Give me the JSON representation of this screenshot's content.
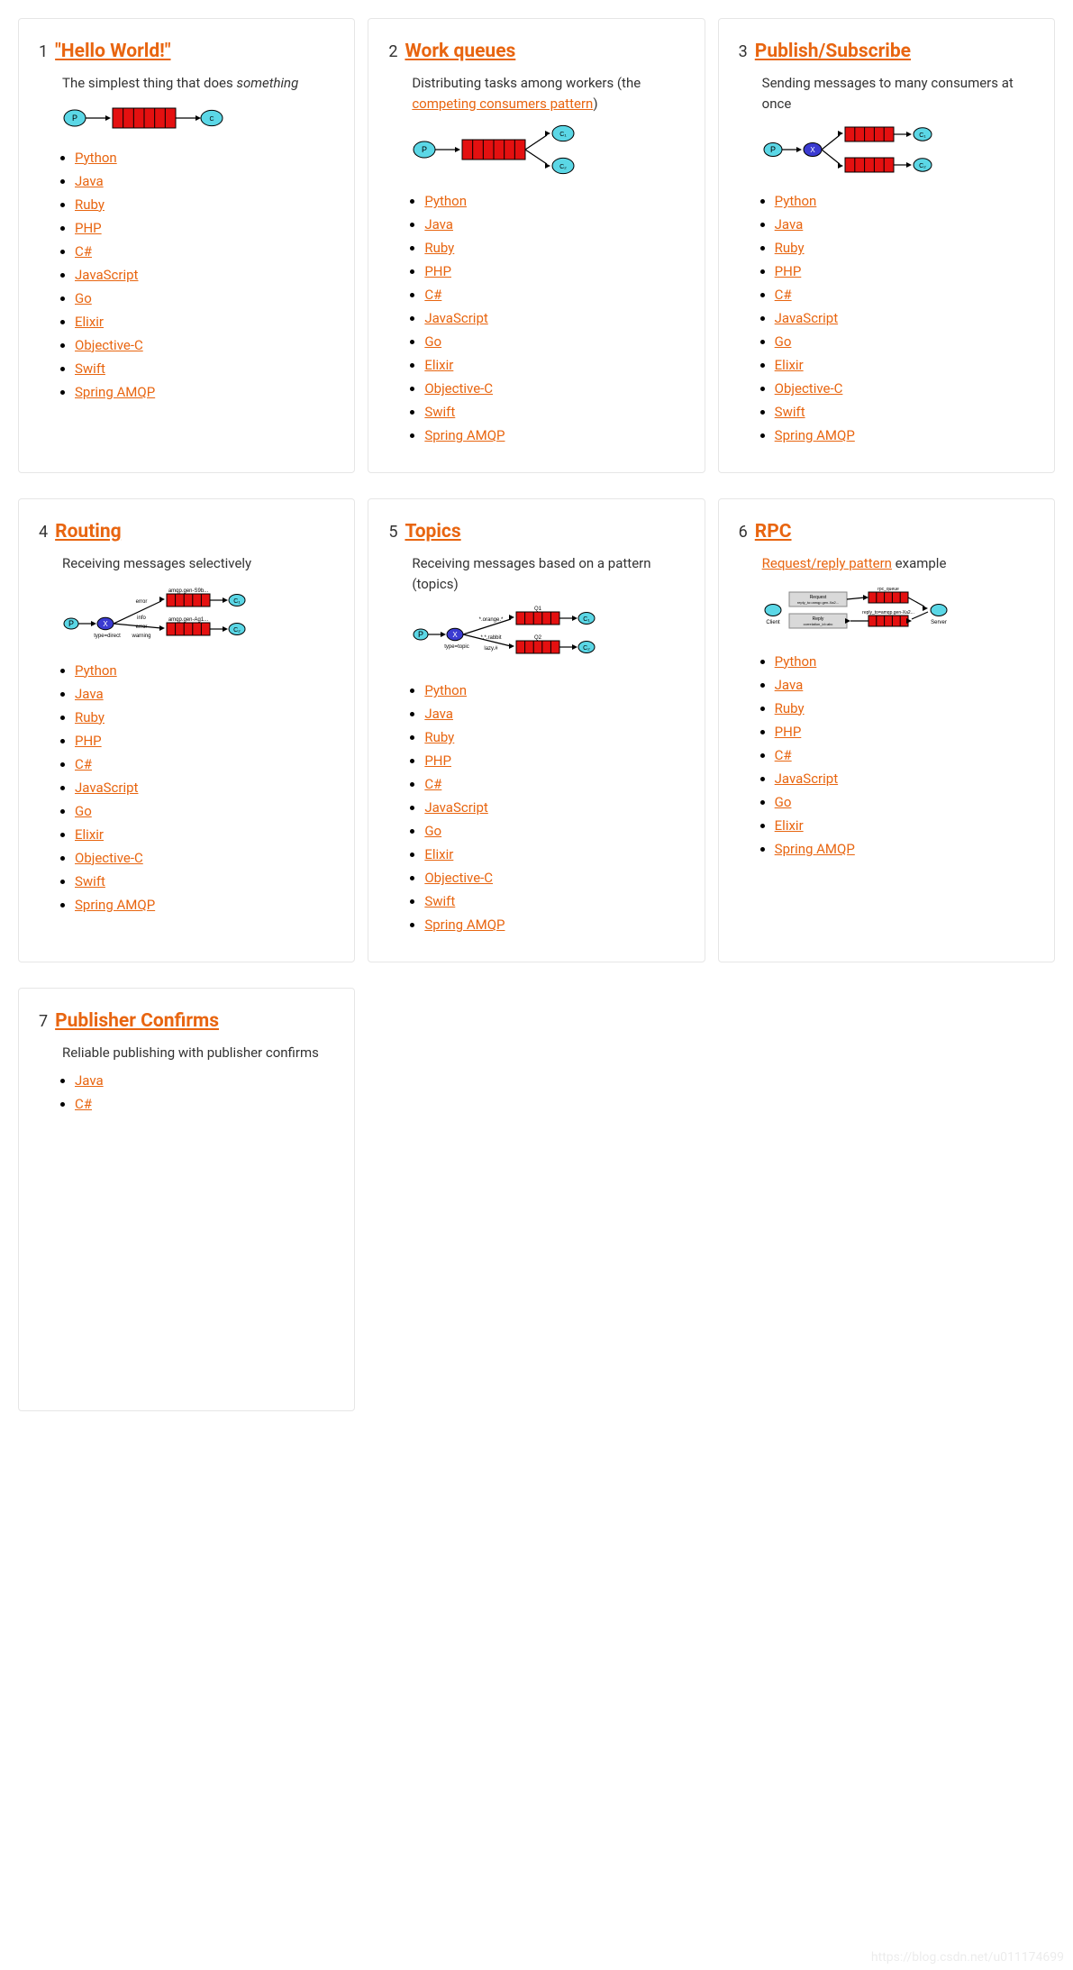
{
  "tutorials": [
    {
      "num": "1",
      "title": "\"Hello World!\"",
      "desc_html": "The simplest thing that does <em>something</em>",
      "diagram": "hello",
      "langs": [
        "Python",
        "Java",
        "Ruby",
        "PHP",
        "C#",
        "JavaScript",
        "Go",
        "Elixir",
        "Objective-C",
        "Swift",
        "Spring AMQP"
      ]
    },
    {
      "num": "2",
      "title": "Work queues",
      "desc_html": "Distributing tasks among workers (the <a class=\"desc-link\" data-name=\"competing-consumers-link\" data-interactable=\"true\">competing consumers pattern</a>)",
      "diagram": "work",
      "langs": [
        "Python",
        "Java",
        "Ruby",
        "PHP",
        "C#",
        "JavaScript",
        "Go",
        "Elixir",
        "Objective-C",
        "Swift",
        "Spring AMQP"
      ]
    },
    {
      "num": "3",
      "title": "Publish/Subscribe",
      "desc_html": "Sending messages to many consumers at once",
      "diagram": "pubsub",
      "langs": [
        "Python",
        "Java",
        "Ruby",
        "PHP",
        "C#",
        "JavaScript",
        "Go",
        "Elixir",
        "Objective-C",
        "Swift",
        "Spring AMQP"
      ]
    },
    {
      "num": "4",
      "title": "Routing",
      "desc_html": "Receiving messages selectively",
      "diagram": "routing",
      "langs": [
        "Python",
        "Java",
        "Ruby",
        "PHP",
        "C#",
        "JavaScript",
        "Go",
        "Elixir",
        "Objective-C",
        "Swift",
        "Spring AMQP"
      ]
    },
    {
      "num": "5",
      "title": "Topics",
      "desc_html": "Receiving messages based on a pattern (topics)",
      "diagram": "topics",
      "langs": [
        "Python",
        "Java",
        "Ruby",
        "PHP",
        "C#",
        "JavaScript",
        "Go",
        "Elixir",
        "Objective-C",
        "Swift",
        "Spring AMQP"
      ]
    },
    {
      "num": "6",
      "title": "RPC",
      "desc_html": "<a class=\"desc-link\" data-name=\"request-reply-link\" data-interactable=\"true\">Request/reply pattern</a> example",
      "diagram": "rpc",
      "langs": [
        "Python",
        "Java",
        "Ruby",
        "PHP",
        "C#",
        "JavaScript",
        "Go",
        "Elixir",
        "Spring AMQP"
      ]
    },
    {
      "num": "7",
      "title": "Publisher Confirms",
      "desc_html": "Reliable publishing with publisher confirms",
      "diagram": "",
      "langs": [
        "Java",
        "C#"
      ]
    }
  ],
  "watermark": "https://blog.csdn.net/u011174699"
}
